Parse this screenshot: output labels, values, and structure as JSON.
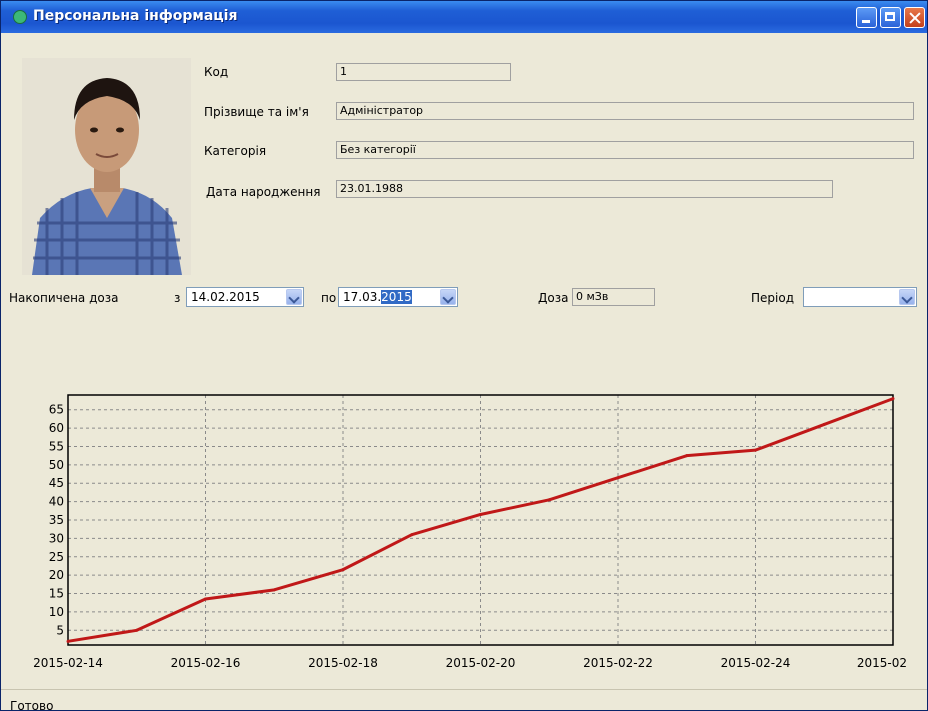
{
  "window": {
    "title": "Персональна інформація"
  },
  "person": {
    "code_label": "Код",
    "code_value": "1",
    "name_label": "Прізвище та ім'я",
    "name_value": "Адміністратор",
    "category_label": "Категорія",
    "category_value": "Без категорії",
    "birthdate_label": "Дата народження",
    "birthdate_value": "23.01.1988"
  },
  "dose_bar": {
    "accumulated_label": "Накопичена доза",
    "from_label": "з",
    "from_value": "14.02.2015",
    "to_label": "по",
    "to_value_prefix": "17.03.",
    "to_value_selected": "2015",
    "dose_label": "Доза",
    "dose_value": "0 мЗв",
    "period_label": "Період",
    "period_value": ""
  },
  "status": {
    "text": "Готово"
  },
  "chart_data": {
    "type": "line",
    "x": [
      "2015-02-14",
      "2015-02-15",
      "2015-02-16",
      "2015-02-17",
      "2015-02-18",
      "2015-02-19",
      "2015-02-20",
      "2015-02-21",
      "2015-02-22",
      "2015-02-23",
      "2015-02-24",
      "2015-02-25",
      "2015-02-26"
    ],
    "series": [
      {
        "values": [
          2,
          5,
          13.5,
          16,
          21.5,
          31,
          36.5,
          40.5,
          46.5,
          52.5,
          54,
          61,
          68
        ],
        "color": "#c01818"
      }
    ],
    "x_tick_labels": [
      "2015-02-14",
      "2015-02-16",
      "2015-02-18",
      "2015-02-20",
      "2015-02-22",
      "2015-02-24",
      "2015-02"
    ],
    "y_ticks": [
      5,
      10,
      15,
      20,
      25,
      30,
      35,
      40,
      45,
      50,
      55,
      60,
      65
    ],
    "ylim": [
      1,
      69
    ],
    "grid": true
  }
}
